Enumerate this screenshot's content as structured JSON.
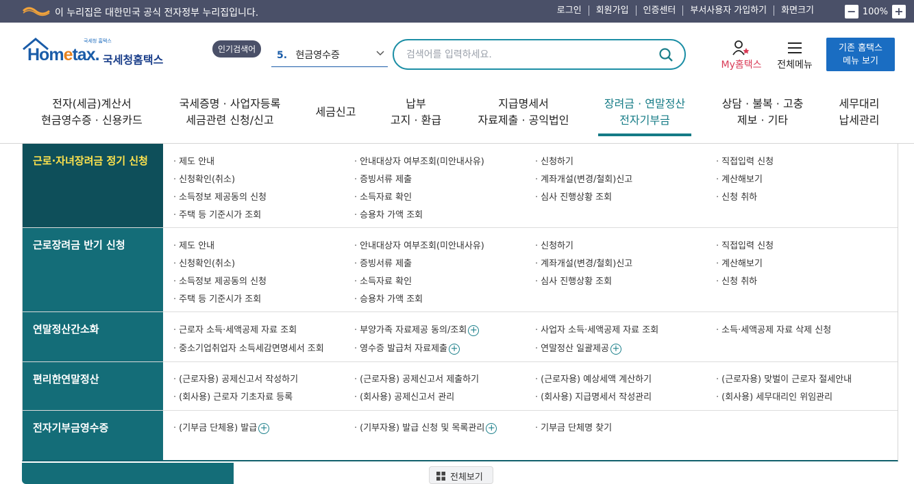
{
  "gov_bar": {
    "notice": "이 누리집은 대한민국 공식 전자정부 누리집입니다.",
    "links": [
      "로그인",
      "회원가입",
      "인증센터",
      "부서사용자 가입하기",
      "화면크기"
    ],
    "zoom": "100%",
    "zoom_minus": "−",
    "zoom_plus": "+"
  },
  "header": {
    "logo_small": "국세청 홈택스",
    "logo_main_pre": "Hom",
    "logo_main_e": "e",
    "logo_main_post": "tax.",
    "logo_kor": "국세청홈택스",
    "popular_label": "인기검색어",
    "popular_rank": "5.",
    "popular_term": "현금영수증",
    "search_placeholder": "검색어를 입력하세요.",
    "my_label": "My홈택스",
    "allmenu_label": "전체메뉴",
    "legacy_line1": "기존 홈택스",
    "legacy_line2": "메뉴 보기"
  },
  "gnb": [
    {
      "l1": "전자(세금)계산서",
      "l2": "현금영수증 · 신용카드"
    },
    {
      "l1": "국세증명 · 사업자등록",
      "l2": "세금관련 신청/신고"
    },
    {
      "l1": "세금신고",
      "l2": ""
    },
    {
      "l1": "납부",
      "l2": "고지 · 환급"
    },
    {
      "l1": "지급명세서",
      "l2": "자료제출 · 공익법인"
    },
    {
      "l1": "장려금 · 연말정산",
      "l2": "전자기부금"
    },
    {
      "l1": "상담 · 불복 · 고충",
      "l2": "제보 · 기타"
    },
    {
      "l1": "세무대리",
      "l2": "납세관리"
    }
  ],
  "mega": {
    "rows": [
      {
        "title": "근로·자녀장려금 정기 신청",
        "items": [
          "제도 안내",
          "안내대상자 여부조회(미안내사유)",
          "신청하기",
          "직접입력 신청",
          "신청확인(취소)",
          "증빙서류 제출",
          "계좌개설(변경/철회)신고",
          "계산해보기",
          "소득정보 제공동의 신청",
          "소득자료 확인",
          "심사 진행상황 조회",
          "신청 취하",
          "주택 등 기준시가 조회",
          "승용차 가액 조회"
        ]
      },
      {
        "title": "근로장려금 반기 신청",
        "items": [
          "제도 안내",
          "안내대상자 여부조회(미안내사유)",
          "신청하기",
          "직접입력 신청",
          "신청확인(취소)",
          "증빙서류 제출",
          "계좌개설(변경/철회)신고",
          "계산해보기",
          "소득정보 제공동의 신청",
          "소득자료 확인",
          "심사 진행상황 조회",
          "신청 취하",
          "주택 등 기준시가 조회",
          "승용차 가액 조회"
        ]
      },
      {
        "title": "연말정산간소화",
        "items": [
          "근로자 소득·세액공제 자료 조회",
          "부양가족 자료제공 동의/조회",
          "사업자 소득·세액공제 자료 조회",
          "소득·세액공제 자료 삭제 신청",
          "중소기업취업자 소득세감면명세서 조회",
          "영수증 발급처 자료제출",
          "연말정산 일괄제공"
        ]
      },
      {
        "title": "편리한연말정산",
        "items": [
          "(근로자용) 공제신고서 작성하기",
          "(근로자용) 공제신고서 제출하기",
          "(근로자용) 예상세액 계산하기",
          "(근로자용) 맞벌이 근로자 절세안내",
          "(회사용) 근로자 기초자료 등록",
          "(회사용) 공제신고서 관리",
          "(회사용) 지급명세서 작성관리",
          "(회사용) 세무대리인 위임관리"
        ]
      },
      {
        "title": "전자기부금영수증",
        "items": [
          "(기부금 단체용) 발급",
          "(기부자용) 발급 신청 및 목록관리",
          "기부금 단체명 찾기"
        ]
      }
    ],
    "plus_symbol": "+"
  },
  "footer": {
    "view_all": "전체보기"
  },
  "colors": {
    "gov_bar": "#4a5068",
    "teal": "#146d78",
    "teal_dark": "#0e4f5a",
    "active_title": "#ffe34d",
    "accent_blue": "#1a6dc2",
    "my_red": "#d93a56"
  }
}
